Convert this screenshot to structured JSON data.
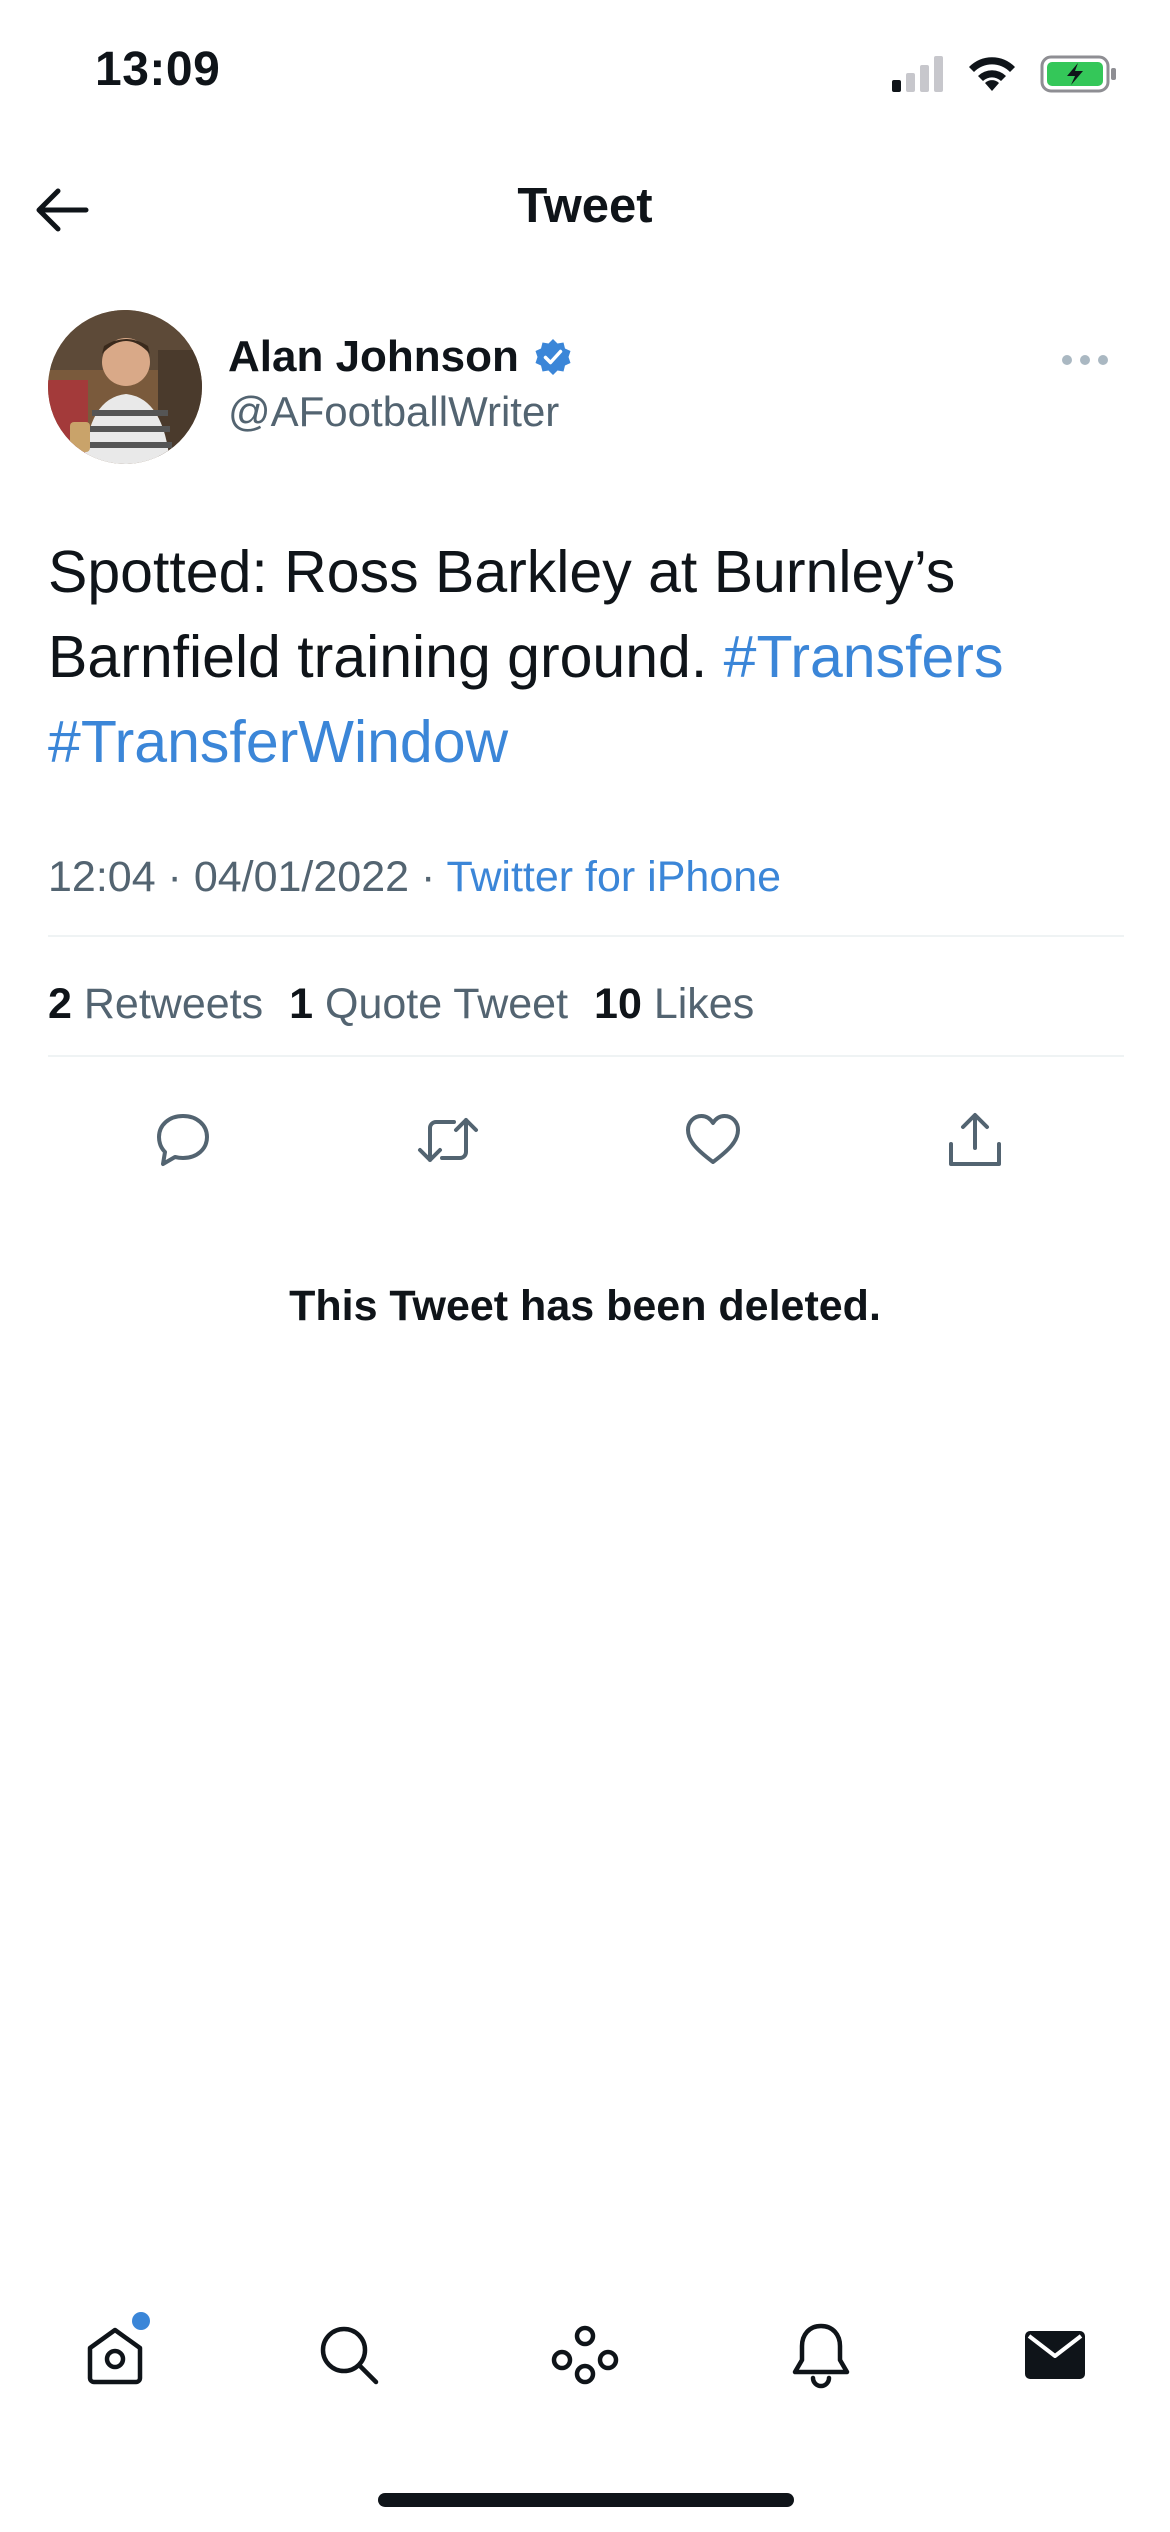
{
  "status_bar": {
    "time": "13:09",
    "icons": [
      "cellular-signal-icon",
      "wifi-icon",
      "battery-charging-icon"
    ],
    "battery_color": "#34c759"
  },
  "header": {
    "title": "Tweet",
    "back_icon": "arrow-left-icon"
  },
  "tweet": {
    "author_name": "Alan Johnson",
    "verified": true,
    "handle": "@AFootballWriter",
    "text_plain": "Spotted: Ross Barkley at Burnley’s Barnfield training ground. ",
    "hashtags": [
      "#Transfers",
      "#TransferWindow"
    ],
    "time": "12:04",
    "date": "04/01/2022",
    "source": "Twitter for iPhone",
    "separator": " · "
  },
  "stats": {
    "retweets_count": "2",
    "retweets_label": "Retweets",
    "quotes_count": "1",
    "quotes_label": "Quote Tweet",
    "likes_count": "10",
    "likes_label": "Likes"
  },
  "actions": [
    "reply-icon",
    "retweet-icon",
    "like-icon",
    "share-icon"
  ],
  "deleted_message": "This Tweet has been deleted.",
  "tab_bar": {
    "tabs": [
      "home-icon",
      "search-icon",
      "spaces-icon",
      "notifications-icon",
      "messages-icon"
    ],
    "home_has_badge": true
  },
  "colors": {
    "accent": "#3b86d8",
    "text_primary": "#0f1419",
    "text_secondary": "#536471",
    "divider": "#eff3f4"
  }
}
